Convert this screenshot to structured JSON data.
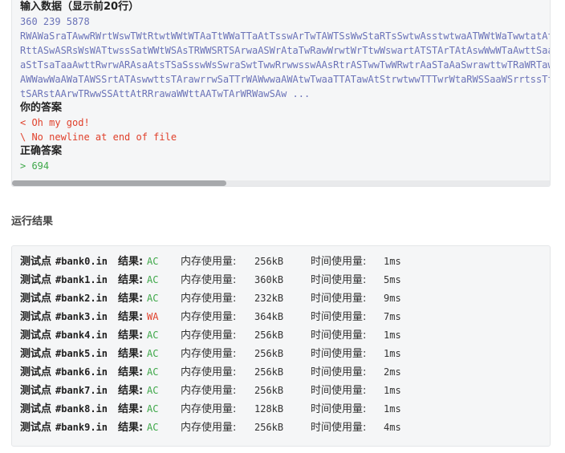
{
  "input_section": {
    "title": "输入数据（显示前20行）",
    "lines": [
      "360 239 5878",
      "RWAWaSraTAwwRWrtWswTWtRtwtWWtWTAaTtWWaTTaAtTsswArTwTAWTSsWwStaRTsSwtwAsstwtwaATWWtWaTwwtatAtaraAWaStrwaRAaWswTs",
      "RttASwASRsWsWATtwssSatWWtWSAsTRWWSRTSArwaASWrAtaTwRawWrwtWrTtwWswartATSTArTAtAswWwWTaAwttSaatwarWsWAatRsrStwTsA",
      "aStTsaTaaAwttRwrwARAsaAtsTSaSsswWsSwraSwtTwwRrwwsswAAsRtrASTwwTwWRwtrAaSTaAaSwrawttwTRaWRTawTTaAswTRswtRaawTTWa",
      "AWWawWaAWaTAWSSrtATAswwttsTArawrrwSaTTrWAWwwaAWAtwTwaaTTATawAtStrwtwwTTTwrWtaRWSSaaWSrrtssTtTtWwaSSRaATawAAWrtr",
      "tSARstAArwTRwwSSAttAtRRrawaWWttAATwTArWRWawSAw ..."
    ],
    "your_answer_label": "你的答案",
    "your_answer_lines": [
      "< Oh my god!",
      "\\ No newline at end of file"
    ],
    "correct_answer_label": "正确答案",
    "correct_answer_line": "> 694"
  },
  "results_section": {
    "title": "运行结果",
    "rows": [
      {
        "label": "测试点",
        "file": "#bank0.in",
        "result_label": "结果:",
        "status": "AC",
        "mem_label": "内存使用量:",
        "mem": "256kB",
        "time_label": "时间使用量:",
        "time": "1ms"
      },
      {
        "label": "测试点",
        "file": "#bank1.in",
        "result_label": "结果:",
        "status": "AC",
        "mem_label": "内存使用量:",
        "mem": "360kB",
        "time_label": "时间使用量:",
        "time": "5ms"
      },
      {
        "label": "测试点",
        "file": "#bank2.in",
        "result_label": "结果:",
        "status": "AC",
        "mem_label": "内存使用量:",
        "mem": "232kB",
        "time_label": "时间使用量:",
        "time": "9ms"
      },
      {
        "label": "测试点",
        "file": "#bank3.in",
        "result_label": "结果:",
        "status": "WA",
        "mem_label": "内存使用量:",
        "mem": "364kB",
        "time_label": "时间使用量:",
        "time": "7ms"
      },
      {
        "label": "测试点",
        "file": "#bank4.in",
        "result_label": "结果:",
        "status": "AC",
        "mem_label": "内存使用量:",
        "mem": "256kB",
        "time_label": "时间使用量:",
        "time": "1ms"
      },
      {
        "label": "测试点",
        "file": "#bank5.in",
        "result_label": "结果:",
        "status": "AC",
        "mem_label": "内存使用量:",
        "mem": "256kB",
        "time_label": "时间使用量:",
        "time": "1ms"
      },
      {
        "label": "测试点",
        "file": "#bank6.in",
        "result_label": "结果:",
        "status": "AC",
        "mem_label": "内存使用量:",
        "mem": "256kB",
        "time_label": "时间使用量:",
        "time": "2ms"
      },
      {
        "label": "测试点",
        "file": "#bank7.in",
        "result_label": "结果:",
        "status": "AC",
        "mem_label": "内存使用量:",
        "mem": "256kB",
        "time_label": "时间使用量:",
        "time": "1ms"
      },
      {
        "label": "测试点",
        "file": "#bank8.in",
        "result_label": "结果:",
        "status": "AC",
        "mem_label": "内存使用量:",
        "mem": "128kB",
        "time_label": "时间使用量:",
        "time": "1ms"
      },
      {
        "label": "测试点",
        "file": "#bank9.in",
        "result_label": "结果:",
        "status": "AC",
        "mem_label": "内存使用量:",
        "mem": "256kB",
        "time_label": "时间使用量:",
        "time": "4ms"
      }
    ]
  },
  "colors": {
    "ac": "#3fa84a",
    "wa": "#e0402b",
    "input_text": "#6b73b8"
  }
}
